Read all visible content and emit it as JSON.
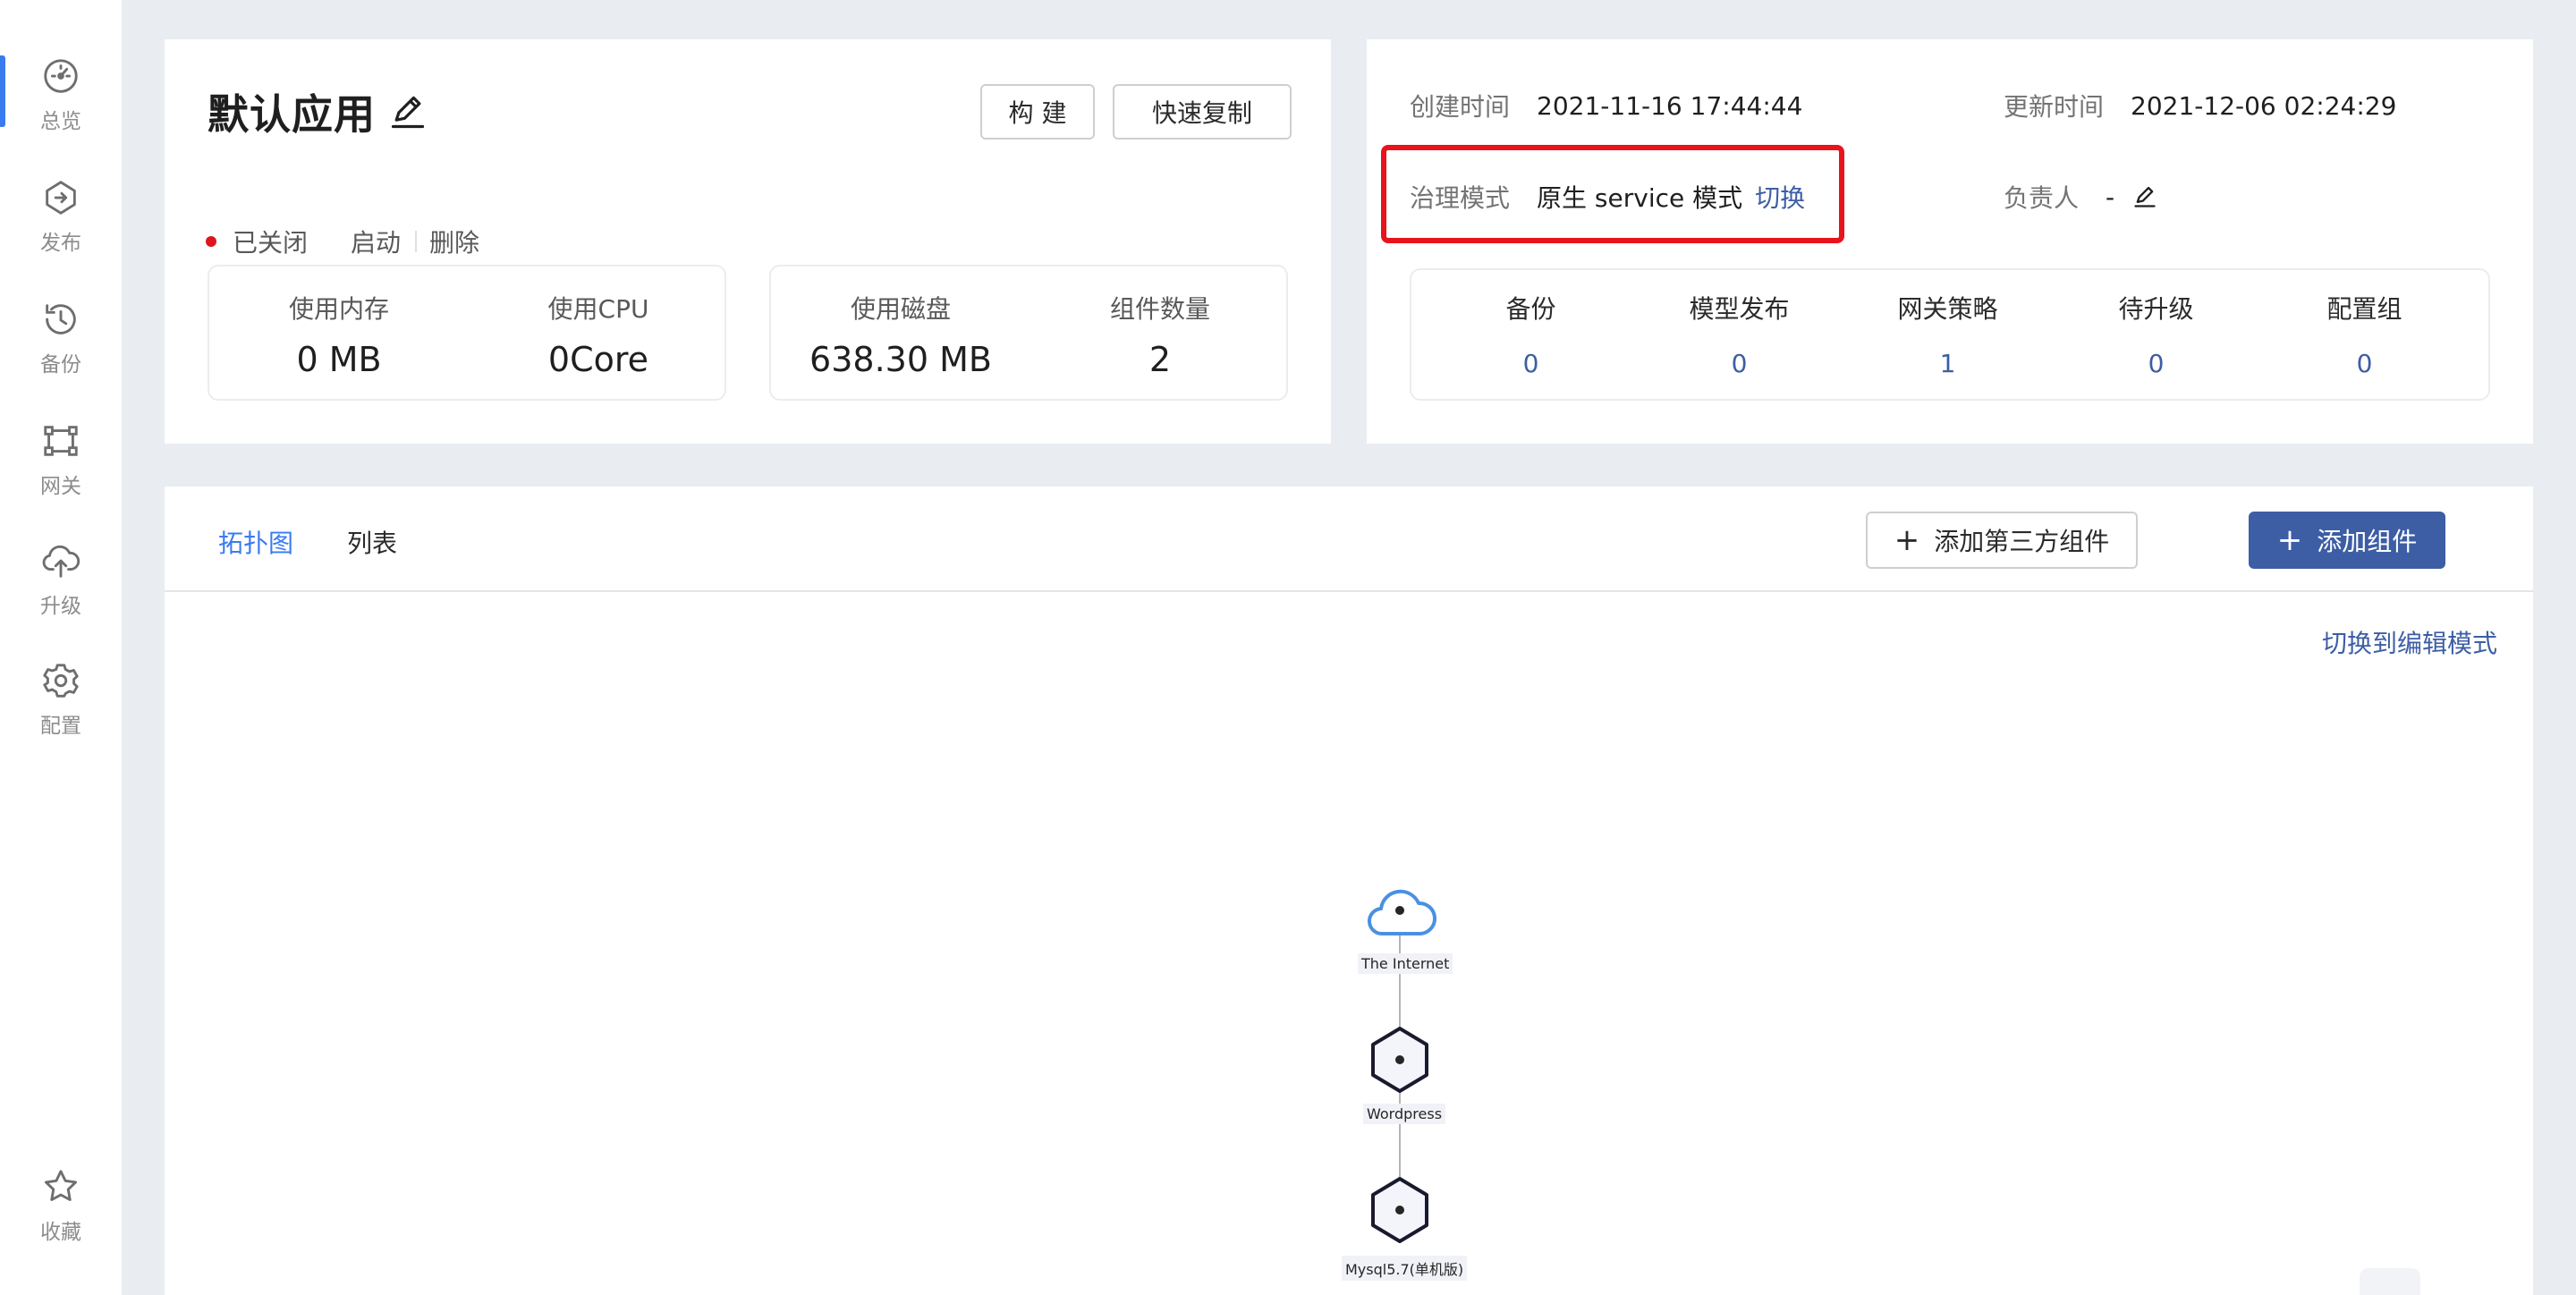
{
  "sidebar": {
    "items": [
      {
        "label": "总览",
        "icon": "dashboard-icon"
      },
      {
        "label": "发布",
        "icon": "publish-icon"
      },
      {
        "label": "备份",
        "icon": "history-icon"
      },
      {
        "label": "网关",
        "icon": "gateway-icon"
      },
      {
        "label": "升级",
        "icon": "cloud-upload-icon"
      },
      {
        "label": "配置",
        "icon": "gear-icon"
      }
    ],
    "favorite": {
      "label": "收藏",
      "icon": "star-icon"
    },
    "active_index": 0
  },
  "app": {
    "title": "默认应用",
    "build_label": "构 建",
    "copy_label": "快速复制",
    "status": "已关闭",
    "status_color": "#e0141e",
    "start_label": "启动",
    "delete_label": "删除",
    "stats": [
      {
        "label": "使用内存",
        "value": "0 MB"
      },
      {
        "label": "使用CPU",
        "value": "0Core"
      },
      {
        "label": "使用磁盘",
        "value": "638.30 MB"
      },
      {
        "label": "组件数量",
        "value": "2"
      }
    ]
  },
  "meta": {
    "created_label": "创建时间",
    "created_value": "2021-11-16 17:44:44",
    "updated_label": "更新时间",
    "updated_value": "2021-12-06 02:24:29",
    "governance_label": "治理模式",
    "governance_value": "原生 service 模式",
    "switch_label": "切换",
    "owner_label": "负责人",
    "owner_value": "-",
    "counts": [
      {
        "label": "备份",
        "value": "0"
      },
      {
        "label": "模型发布",
        "value": "0"
      },
      {
        "label": "网关策略",
        "value": "1"
      },
      {
        "label": "待升级",
        "value": "0"
      },
      {
        "label": "配置组",
        "value": "0"
      }
    ]
  },
  "topology": {
    "tabs": [
      "拓扑图",
      "列表"
    ],
    "active_tab": 0,
    "add_third_label": "添加第三方组件",
    "add_component_label": "添加组件",
    "edit_mode_label": "切换到编辑模式",
    "nodes": [
      {
        "label": "The Internet",
        "icon": "cloud-icon"
      },
      {
        "label": "Wordpress",
        "icon": "hexagon-icon"
      },
      {
        "label": "Mysql5.7(单机版)",
        "icon": "hexagon-icon"
      }
    ]
  },
  "colors": {
    "accent": "#3a7bf0",
    "primary_button": "#3d5ea5",
    "link": "#3d5ea5",
    "highlight_border": "#e8131b"
  }
}
